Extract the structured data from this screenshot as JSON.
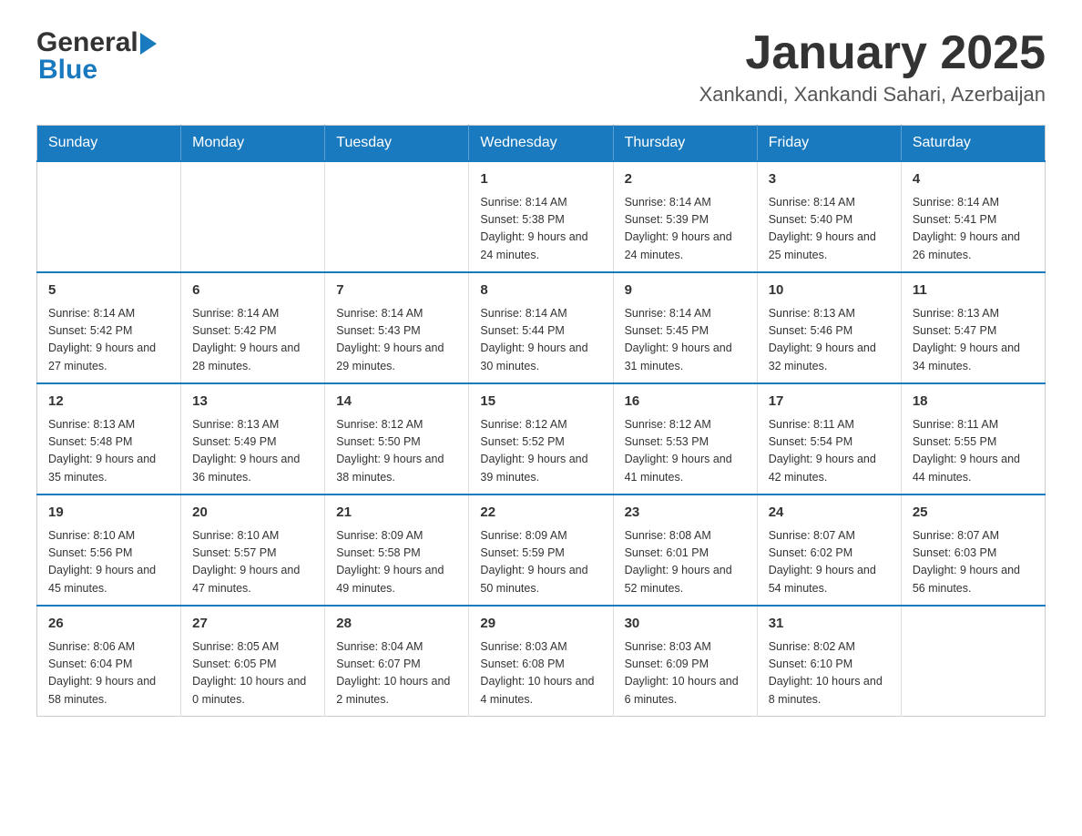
{
  "header": {
    "logo_general": "General",
    "logo_blue": "Blue",
    "title": "January 2025",
    "subtitle": "Xankandi, Xankandi Sahari, Azerbaijan"
  },
  "days_of_week": [
    "Sunday",
    "Monday",
    "Tuesday",
    "Wednesday",
    "Thursday",
    "Friday",
    "Saturday"
  ],
  "weeks": [
    [
      {
        "day": "",
        "info": ""
      },
      {
        "day": "",
        "info": ""
      },
      {
        "day": "",
        "info": ""
      },
      {
        "day": "1",
        "info": "Sunrise: 8:14 AM\nSunset: 5:38 PM\nDaylight: 9 hours\nand 24 minutes."
      },
      {
        "day": "2",
        "info": "Sunrise: 8:14 AM\nSunset: 5:39 PM\nDaylight: 9 hours\nand 24 minutes."
      },
      {
        "day": "3",
        "info": "Sunrise: 8:14 AM\nSunset: 5:40 PM\nDaylight: 9 hours\nand 25 minutes."
      },
      {
        "day": "4",
        "info": "Sunrise: 8:14 AM\nSunset: 5:41 PM\nDaylight: 9 hours\nand 26 minutes."
      }
    ],
    [
      {
        "day": "5",
        "info": "Sunrise: 8:14 AM\nSunset: 5:42 PM\nDaylight: 9 hours\nand 27 minutes."
      },
      {
        "day": "6",
        "info": "Sunrise: 8:14 AM\nSunset: 5:42 PM\nDaylight: 9 hours\nand 28 minutes."
      },
      {
        "day": "7",
        "info": "Sunrise: 8:14 AM\nSunset: 5:43 PM\nDaylight: 9 hours\nand 29 minutes."
      },
      {
        "day": "8",
        "info": "Sunrise: 8:14 AM\nSunset: 5:44 PM\nDaylight: 9 hours\nand 30 minutes."
      },
      {
        "day": "9",
        "info": "Sunrise: 8:14 AM\nSunset: 5:45 PM\nDaylight: 9 hours\nand 31 minutes."
      },
      {
        "day": "10",
        "info": "Sunrise: 8:13 AM\nSunset: 5:46 PM\nDaylight: 9 hours\nand 32 minutes."
      },
      {
        "day": "11",
        "info": "Sunrise: 8:13 AM\nSunset: 5:47 PM\nDaylight: 9 hours\nand 34 minutes."
      }
    ],
    [
      {
        "day": "12",
        "info": "Sunrise: 8:13 AM\nSunset: 5:48 PM\nDaylight: 9 hours\nand 35 minutes."
      },
      {
        "day": "13",
        "info": "Sunrise: 8:13 AM\nSunset: 5:49 PM\nDaylight: 9 hours\nand 36 minutes."
      },
      {
        "day": "14",
        "info": "Sunrise: 8:12 AM\nSunset: 5:50 PM\nDaylight: 9 hours\nand 38 minutes."
      },
      {
        "day": "15",
        "info": "Sunrise: 8:12 AM\nSunset: 5:52 PM\nDaylight: 9 hours\nand 39 minutes."
      },
      {
        "day": "16",
        "info": "Sunrise: 8:12 AM\nSunset: 5:53 PM\nDaylight: 9 hours\nand 41 minutes."
      },
      {
        "day": "17",
        "info": "Sunrise: 8:11 AM\nSunset: 5:54 PM\nDaylight: 9 hours\nand 42 minutes."
      },
      {
        "day": "18",
        "info": "Sunrise: 8:11 AM\nSunset: 5:55 PM\nDaylight: 9 hours\nand 44 minutes."
      }
    ],
    [
      {
        "day": "19",
        "info": "Sunrise: 8:10 AM\nSunset: 5:56 PM\nDaylight: 9 hours\nand 45 minutes."
      },
      {
        "day": "20",
        "info": "Sunrise: 8:10 AM\nSunset: 5:57 PM\nDaylight: 9 hours\nand 47 minutes."
      },
      {
        "day": "21",
        "info": "Sunrise: 8:09 AM\nSunset: 5:58 PM\nDaylight: 9 hours\nand 49 minutes."
      },
      {
        "day": "22",
        "info": "Sunrise: 8:09 AM\nSunset: 5:59 PM\nDaylight: 9 hours\nand 50 minutes."
      },
      {
        "day": "23",
        "info": "Sunrise: 8:08 AM\nSunset: 6:01 PM\nDaylight: 9 hours\nand 52 minutes."
      },
      {
        "day": "24",
        "info": "Sunrise: 8:07 AM\nSunset: 6:02 PM\nDaylight: 9 hours\nand 54 minutes."
      },
      {
        "day": "25",
        "info": "Sunrise: 8:07 AM\nSunset: 6:03 PM\nDaylight: 9 hours\nand 56 minutes."
      }
    ],
    [
      {
        "day": "26",
        "info": "Sunrise: 8:06 AM\nSunset: 6:04 PM\nDaylight: 9 hours\nand 58 minutes."
      },
      {
        "day": "27",
        "info": "Sunrise: 8:05 AM\nSunset: 6:05 PM\nDaylight: 10 hours\nand 0 minutes."
      },
      {
        "day": "28",
        "info": "Sunrise: 8:04 AM\nSunset: 6:07 PM\nDaylight: 10 hours\nand 2 minutes."
      },
      {
        "day": "29",
        "info": "Sunrise: 8:03 AM\nSunset: 6:08 PM\nDaylight: 10 hours\nand 4 minutes."
      },
      {
        "day": "30",
        "info": "Sunrise: 8:03 AM\nSunset: 6:09 PM\nDaylight: 10 hours\nand 6 minutes."
      },
      {
        "day": "31",
        "info": "Sunrise: 8:02 AM\nSunset: 6:10 PM\nDaylight: 10 hours\nand 8 minutes."
      },
      {
        "day": "",
        "info": ""
      }
    ]
  ]
}
